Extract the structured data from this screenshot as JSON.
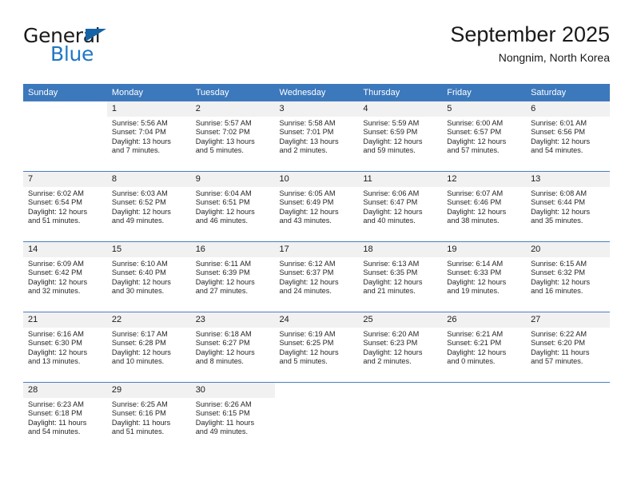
{
  "brand": {
    "name_top": "General",
    "name_bottom": "Blue",
    "triangle_color": "#1464a5",
    "blue_color": "#1f77c4"
  },
  "header": {
    "title": "September 2025",
    "subtitle": "Nongnim, North Korea"
  },
  "theme": {
    "header_bg": "#3c78bc",
    "header_text": "#ffffff",
    "daynum_bg": "#f1f1f1",
    "row_divider": "#4a7fbf"
  },
  "weekdays": [
    "Sunday",
    "Monday",
    "Tuesday",
    "Wednesday",
    "Thursday",
    "Friday",
    "Saturday"
  ],
  "weeks": [
    [
      {
        "day": ""
      },
      {
        "day": "1",
        "sunrise": "Sunrise: 5:56 AM",
        "sunset": "Sunset: 7:04 PM",
        "daylight1": "Daylight: 13 hours",
        "daylight2": "and 7 minutes."
      },
      {
        "day": "2",
        "sunrise": "Sunrise: 5:57 AM",
        "sunset": "Sunset: 7:02 PM",
        "daylight1": "Daylight: 13 hours",
        "daylight2": "and 5 minutes."
      },
      {
        "day": "3",
        "sunrise": "Sunrise: 5:58 AM",
        "sunset": "Sunset: 7:01 PM",
        "daylight1": "Daylight: 13 hours",
        "daylight2": "and 2 minutes."
      },
      {
        "day": "4",
        "sunrise": "Sunrise: 5:59 AM",
        "sunset": "Sunset: 6:59 PM",
        "daylight1": "Daylight: 12 hours",
        "daylight2": "and 59 minutes."
      },
      {
        "day": "5",
        "sunrise": "Sunrise: 6:00 AM",
        "sunset": "Sunset: 6:57 PM",
        "daylight1": "Daylight: 12 hours",
        "daylight2": "and 57 minutes."
      },
      {
        "day": "6",
        "sunrise": "Sunrise: 6:01 AM",
        "sunset": "Sunset: 6:56 PM",
        "daylight1": "Daylight: 12 hours",
        "daylight2": "and 54 minutes."
      }
    ],
    [
      {
        "day": "7",
        "sunrise": "Sunrise: 6:02 AM",
        "sunset": "Sunset: 6:54 PM",
        "daylight1": "Daylight: 12 hours",
        "daylight2": "and 51 minutes."
      },
      {
        "day": "8",
        "sunrise": "Sunrise: 6:03 AM",
        "sunset": "Sunset: 6:52 PM",
        "daylight1": "Daylight: 12 hours",
        "daylight2": "and 49 minutes."
      },
      {
        "day": "9",
        "sunrise": "Sunrise: 6:04 AM",
        "sunset": "Sunset: 6:51 PM",
        "daylight1": "Daylight: 12 hours",
        "daylight2": "and 46 minutes."
      },
      {
        "day": "10",
        "sunrise": "Sunrise: 6:05 AM",
        "sunset": "Sunset: 6:49 PM",
        "daylight1": "Daylight: 12 hours",
        "daylight2": "and 43 minutes."
      },
      {
        "day": "11",
        "sunrise": "Sunrise: 6:06 AM",
        "sunset": "Sunset: 6:47 PM",
        "daylight1": "Daylight: 12 hours",
        "daylight2": "and 40 minutes."
      },
      {
        "day": "12",
        "sunrise": "Sunrise: 6:07 AM",
        "sunset": "Sunset: 6:46 PM",
        "daylight1": "Daylight: 12 hours",
        "daylight2": "and 38 minutes."
      },
      {
        "day": "13",
        "sunrise": "Sunrise: 6:08 AM",
        "sunset": "Sunset: 6:44 PM",
        "daylight1": "Daylight: 12 hours",
        "daylight2": "and 35 minutes."
      }
    ],
    [
      {
        "day": "14",
        "sunrise": "Sunrise: 6:09 AM",
        "sunset": "Sunset: 6:42 PM",
        "daylight1": "Daylight: 12 hours",
        "daylight2": "and 32 minutes."
      },
      {
        "day": "15",
        "sunrise": "Sunrise: 6:10 AM",
        "sunset": "Sunset: 6:40 PM",
        "daylight1": "Daylight: 12 hours",
        "daylight2": "and 30 minutes."
      },
      {
        "day": "16",
        "sunrise": "Sunrise: 6:11 AM",
        "sunset": "Sunset: 6:39 PM",
        "daylight1": "Daylight: 12 hours",
        "daylight2": "and 27 minutes."
      },
      {
        "day": "17",
        "sunrise": "Sunrise: 6:12 AM",
        "sunset": "Sunset: 6:37 PM",
        "daylight1": "Daylight: 12 hours",
        "daylight2": "and 24 minutes."
      },
      {
        "day": "18",
        "sunrise": "Sunrise: 6:13 AM",
        "sunset": "Sunset: 6:35 PM",
        "daylight1": "Daylight: 12 hours",
        "daylight2": "and 21 minutes."
      },
      {
        "day": "19",
        "sunrise": "Sunrise: 6:14 AM",
        "sunset": "Sunset: 6:33 PM",
        "daylight1": "Daylight: 12 hours",
        "daylight2": "and 19 minutes."
      },
      {
        "day": "20",
        "sunrise": "Sunrise: 6:15 AM",
        "sunset": "Sunset: 6:32 PM",
        "daylight1": "Daylight: 12 hours",
        "daylight2": "and 16 minutes."
      }
    ],
    [
      {
        "day": "21",
        "sunrise": "Sunrise: 6:16 AM",
        "sunset": "Sunset: 6:30 PM",
        "daylight1": "Daylight: 12 hours",
        "daylight2": "and 13 minutes."
      },
      {
        "day": "22",
        "sunrise": "Sunrise: 6:17 AM",
        "sunset": "Sunset: 6:28 PM",
        "daylight1": "Daylight: 12 hours",
        "daylight2": "and 10 minutes."
      },
      {
        "day": "23",
        "sunrise": "Sunrise: 6:18 AM",
        "sunset": "Sunset: 6:27 PM",
        "daylight1": "Daylight: 12 hours",
        "daylight2": "and 8 minutes."
      },
      {
        "day": "24",
        "sunrise": "Sunrise: 6:19 AM",
        "sunset": "Sunset: 6:25 PM",
        "daylight1": "Daylight: 12 hours",
        "daylight2": "and 5 minutes."
      },
      {
        "day": "25",
        "sunrise": "Sunrise: 6:20 AM",
        "sunset": "Sunset: 6:23 PM",
        "daylight1": "Daylight: 12 hours",
        "daylight2": "and 2 minutes."
      },
      {
        "day": "26",
        "sunrise": "Sunrise: 6:21 AM",
        "sunset": "Sunset: 6:21 PM",
        "daylight1": "Daylight: 12 hours",
        "daylight2": "and 0 minutes."
      },
      {
        "day": "27",
        "sunrise": "Sunrise: 6:22 AM",
        "sunset": "Sunset: 6:20 PM",
        "daylight1": "Daylight: 11 hours",
        "daylight2": "and 57 minutes."
      }
    ],
    [
      {
        "day": "28",
        "sunrise": "Sunrise: 6:23 AM",
        "sunset": "Sunset: 6:18 PM",
        "daylight1": "Daylight: 11 hours",
        "daylight2": "and 54 minutes."
      },
      {
        "day": "29",
        "sunrise": "Sunrise: 6:25 AM",
        "sunset": "Sunset: 6:16 PM",
        "daylight1": "Daylight: 11 hours",
        "daylight2": "and 51 minutes."
      },
      {
        "day": "30",
        "sunrise": "Sunrise: 6:26 AM",
        "sunset": "Sunset: 6:15 PM",
        "daylight1": "Daylight: 11 hours",
        "daylight2": "and 49 minutes."
      },
      {
        "day": ""
      },
      {
        "day": ""
      },
      {
        "day": ""
      },
      {
        "day": ""
      }
    ]
  ]
}
